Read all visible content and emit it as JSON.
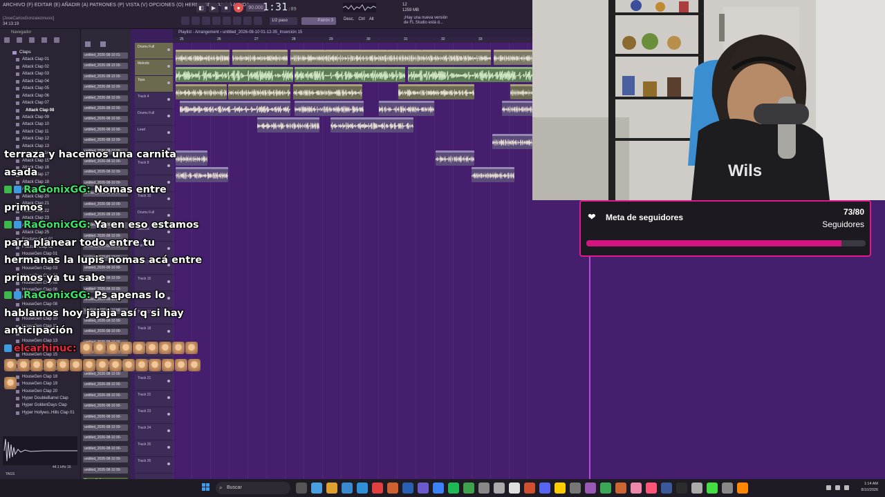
{
  "menubar": {
    "menu_text": "ARCHIVO (F) EDITAR (E) AÑADIR (A) PATRONES (P) VISTA (V) OPCIONES (O) HERRAMIENTAS (T) AYUDA",
    "user": "[JoseCarlosGonzalezmusic]",
    "small_time": "34:13:19",
    "bpm": "90.000",
    "clock": "1:31",
    "clock_sub": ":09",
    "mem_line1": "12",
    "mem_line2": "1259 MB",
    "news": "¡Hay una nueva versión de FL Studio está d...",
    "step": "1/2 paso",
    "pattern": "Patrón 3",
    "ptool": [
      "Desc.",
      "Ctrl",
      "Alt"
    ]
  },
  "browser": {
    "title": "Navegador",
    "items": [
      {
        "label": "Claps",
        "type": "folder"
      },
      {
        "label": "Attack Clap 01"
      },
      {
        "label": "Attack Clap 02"
      },
      {
        "label": "Attack Clap 03"
      },
      {
        "label": "Attack Clap 04"
      },
      {
        "label": "Attack Clap 05"
      },
      {
        "label": "Attack Clap 06"
      },
      {
        "label": "Attack Clap 07"
      },
      {
        "label": "Attack Clap 08",
        "type": "active"
      },
      {
        "label": "Attack Clap 09"
      },
      {
        "label": "Attack Clap 10"
      },
      {
        "label": "Attack Clap 11"
      },
      {
        "label": "Attack Clap 12"
      },
      {
        "label": "Attack Clap 13"
      },
      {
        "label": "Attack Clap 14"
      },
      {
        "label": "Attack Clap 15"
      },
      {
        "label": "Attack Clap 16"
      },
      {
        "label": "Attack Clap 17"
      },
      {
        "label": "Attack Clap 18"
      },
      {
        "label": "Attack Clap 19"
      },
      {
        "label": "Attack Clap 20"
      },
      {
        "label": "Attack Clap 21"
      },
      {
        "label": "Attack Clap 22"
      },
      {
        "label": "Attack Clap 23"
      },
      {
        "label": "Attack Clap 24"
      },
      {
        "label": "Attack Clap 25"
      },
      {
        "label": "Fracture Clap 01"
      },
      {
        "label": "Fracture Clap 02"
      },
      {
        "label": "HouseGen Clap 01"
      },
      {
        "label": "HouseGen Clap 02"
      },
      {
        "label": "HouseGen Clap 03"
      },
      {
        "label": "HouseGen Clap 04"
      },
      {
        "label": "HouseGen Clap 05"
      },
      {
        "label": "HouseGen Clap 06"
      },
      {
        "label": "HouseGen Clap 07"
      },
      {
        "label": "HouseGen Clap 08"
      },
      {
        "label": "HouseGen Clap 09"
      },
      {
        "label": "HouseGen Clap 10"
      },
      {
        "label": "HouseGen Clap 11"
      },
      {
        "label": "HouseGen Clap 12"
      },
      {
        "label": "HouseGen Clap 13"
      },
      {
        "label": "HouseGen Clap 14"
      },
      {
        "label": "HouseGen Clap 15"
      },
      {
        "label": "HouseGen Clap 16"
      },
      {
        "label": "HouseGen Clap 17"
      },
      {
        "label": "HouseGen Clap 18"
      },
      {
        "label": "HouseGen Clap 19"
      },
      {
        "label": "HouseGen Clap 20"
      },
      {
        "label": "Hyper DoubleBarrel Clap"
      },
      {
        "label": "Hyper GoldenDays Clap"
      },
      {
        "label": "Hyper Hollywo..Hills Clap 01"
      }
    ],
    "sample_rate": "44.1 kHz 16",
    "tags": "TAGS"
  },
  "channels": {
    "items": [
      "untitled_2026-08-10 01-",
      "untitled_2026-08-10 00-",
      "untitled_2026-08-10 00-",
      "untitled_2026-08-10 00-",
      "untitled_2026-08-10 00-",
      "untitled_2026-08-10 00-",
      "untitled_2026-08-10 00-",
      "untitled_2026-08-10 00-",
      "untitled_2026-08-10 00-",
      "untitled_2026-08-10 00-",
      "untitled_2026-08-10 00-",
      "untitled_2026-08-10 00-",
      "untitled_2026-08-10 00-",
      "untitled_2026-08-10 00-",
      "untitled_2026-08-10 00-",
      "untitled_2026-08-10 00-",
      "untitled_2026-08-10 00-",
      "untitled_2026-08-10 00-",
      "untitled_2026-08-10 00-",
      "untitled_2026-08-10 00-",
      "untitled_2026-08-10 00-",
      "untitled_2026-08-10 00-",
      "untitled_2026-08-10 00-",
      "untitled_2026-08-10 00-",
      "untitled_2026-08-10 00-",
      "untitled_2026-08-10 00-",
      "untitled_2026-08-10 00-",
      "untitled_2026-08-10 00-",
      "untitled_2026-08-10 00-",
      "untitled_2026-08-10 00-",
      "untitled_2026-08-10 00-",
      "untitled_2026-08-10 00-",
      "untitled_2026-08-10 00-",
      "untitled_2026-08-10 00-",
      "untitled_2026-08-10 00-",
      "untitled_2026-08-10 00-",
      "untitled_2026-08-10 00-",
      "untitled_2026-08-10 00-",
      "untitled_2026-08-10 00-",
      "untitled_2026-08-10 00-",
      "Drums Full",
      "Melodic"
    ]
  },
  "tracks": {
    "labels": [
      "Drums Full",
      "Melodic",
      "Tops",
      "Track 4",
      "Drums Full",
      "Lead",
      "",
      "Track 8",
      "",
      "Track 10",
      "Drums Full",
      "Melodic",
      "Percussion",
      "Track 14",
      "Track 15",
      "Track 16",
      "Track 17",
      "Track 18",
      "Track 19",
      "Track 20",
      "Track 21",
      "Track 22",
      "Track 23",
      "Track 24",
      "Track 25",
      "Track 26"
    ]
  },
  "playlist": {
    "title": "Playlist - Arrangement",
    "file": "untitled_2026-08-10 01-12-35_Inserción 15",
    "ruler": [
      "25",
      "26",
      "27",
      "28",
      "29",
      "30",
      "31",
      "32",
      "33"
    ],
    "clips": [
      {
        "label": "Drums Full",
        "kind": "drum"
      },
      {
        "label": "Lead",
        "kind": "lead"
      },
      {
        "label": "Tops",
        "kind": "tops"
      },
      {
        "label": "untitled_2026-08-10 01-12-42_Inserción 15",
        "kind": "audio"
      },
      {
        "label": "untitled_2026-08-10 00-51-07_Inserción 15",
        "kind": "audio"
      },
      {
        "label": "untitled_2026-08-10 00-48_Inserción 15",
        "kind": "audio"
      },
      {
        "label": "untitled_20_Inserción 15",
        "kind": "audio"
      },
      {
        "label": "untitled_2026-08-10 00-23_Inserción 15",
        "kind": "audio"
      },
      {
        "label": "FL Keyfreq - 1_1528.90",
        "kind": "audio"
      },
      {
        "label": "untitled_2026...",
        "kind": "audio"
      },
      {
        "label": "Fruity Parametric 2 de la mezcla",
        "kind": "audio"
      },
      {
        "label": "untitled_2_Inserción 15",
        "kind": "audio"
      },
      {
        "label": "untitled_20_Inserción 15",
        "kind": "audio"
      },
      {
        "label": "Percussion",
        "kind": "tops"
      }
    ]
  },
  "goal": {
    "title": "Meta de seguidores",
    "count": "73/80",
    "label": "Seguidores",
    "progress": 0.9125,
    "accent": "#e01a8d"
  },
  "chat": {
    "lines": [
      {
        "text": "terraza y hacemos una carnita asada"
      },
      {
        "badges": [
          "mod",
          "prime"
        ],
        "name": "RaGonixGG:",
        "text": "Nomas entre primos"
      },
      {
        "badges": [
          "mod",
          "prime"
        ],
        "name": "RaGonixGG:",
        "text": "Ya en eso estamos para planear todo entre tu hermanas la lupis nomas acá entre primos ya tu sabe"
      },
      {
        "badges": [
          "mod",
          "prime"
        ],
        "name": "RaGonixGG:",
        "text": "Ps apenas lo hablamos hoy jajaja así q si hay anticipación"
      }
    ],
    "emote_user": "elcarhinuc:",
    "emote_count": 25
  },
  "taskbar": {
    "search": "Buscar",
    "time": "1:14 AM",
    "date": "8/10/2026"
  }
}
